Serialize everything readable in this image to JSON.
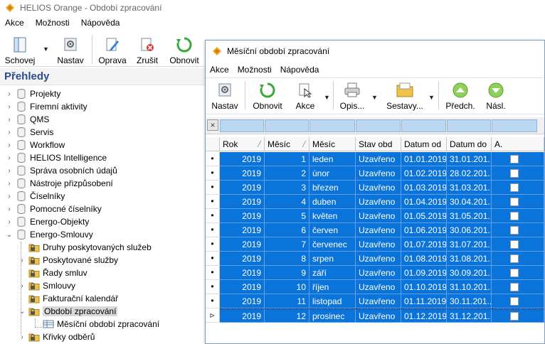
{
  "app": {
    "title": "HELIOS Orange - Období zpracování",
    "menu": [
      "Akce",
      "Možnosti",
      "Nápověda"
    ],
    "toolbar": {
      "schovej": "Schovej",
      "nastav": "Nastav",
      "oprava": "Oprava",
      "zrusit": "Zrušit",
      "obnovit": "Obnovit"
    }
  },
  "sidebar": {
    "header": "Přehledy",
    "items": [
      {
        "label": "Projekty"
      },
      {
        "label": "Firemní aktivity"
      },
      {
        "label": "QMS"
      },
      {
        "label": "Servis"
      },
      {
        "label": "Workflow"
      },
      {
        "label": "HELIOS Intelligence"
      },
      {
        "label": "Správa osobních údajů"
      },
      {
        "label": "Nástroje přizpůsobení"
      },
      {
        "label": "Číselníky"
      },
      {
        "label": "Pomocné číselníky"
      },
      {
        "label": "Energo-Objekty"
      },
      {
        "label": "Energo-Smlouvy"
      },
      {
        "label": "Druhy poskytovaných služeb"
      },
      {
        "label": "Poskytované služby"
      },
      {
        "label": "Řady smluv"
      },
      {
        "label": "Smlouvy"
      },
      {
        "label": "Fakturační kalendář"
      },
      {
        "label": "Období zpracování"
      },
      {
        "label": "Měsíční období zpracování"
      },
      {
        "label": "Křivky odběrů"
      }
    ]
  },
  "child": {
    "title": "Měsíční období zpracování",
    "menu": [
      "Akce",
      "Možnosti",
      "Nápověda"
    ],
    "toolbar": {
      "nastav": "Nastav",
      "obnovit": "Obnovit",
      "akce": "Akce",
      "opis": "Opis...",
      "sestavy": "Sestavy...",
      "predch": "Předch.",
      "nasl": "Násl."
    },
    "columns": [
      "Rok",
      "Měsíc",
      "Měsíc",
      "Stav obd",
      "Datum od",
      "Datum do",
      "A."
    ],
    "rows": [
      {
        "rok": "2019",
        "mesic": "1",
        "nazev": "leden",
        "stav": "Uzavřeno",
        "od": "01.01.2019",
        "do": "31.01.201..."
      },
      {
        "rok": "2019",
        "mesic": "2",
        "nazev": "únor",
        "stav": "Uzavřeno",
        "od": "01.02.2019",
        "do": "28.02.201..."
      },
      {
        "rok": "2019",
        "mesic": "3",
        "nazev": "březen",
        "stav": "Uzavřeno",
        "od": "01.03.2019",
        "do": "31.03.201..."
      },
      {
        "rok": "2019",
        "mesic": "4",
        "nazev": "duben",
        "stav": "Uzavřeno",
        "od": "01.04.2019",
        "do": "30.04.201..."
      },
      {
        "rok": "2019",
        "mesic": "5",
        "nazev": "květen",
        "stav": "Uzavřeno",
        "od": "01.05.2019",
        "do": "31.05.201..."
      },
      {
        "rok": "2019",
        "mesic": "6",
        "nazev": "červen",
        "stav": "Uzavřeno",
        "od": "01.06.2019",
        "do": "30.06.201..."
      },
      {
        "rok": "2019",
        "mesic": "7",
        "nazev": "červenec",
        "stav": "Uzavřeno",
        "od": "01.07.2019",
        "do": "31.07.201..."
      },
      {
        "rok": "2019",
        "mesic": "8",
        "nazev": "srpen",
        "stav": "Uzavřeno",
        "od": "01.08.2019",
        "do": "31.08.201..."
      },
      {
        "rok": "2019",
        "mesic": "9",
        "nazev": "září",
        "stav": "Uzavřeno",
        "od": "01.09.2019",
        "do": "30.09.201..."
      },
      {
        "rok": "2019",
        "mesic": "10",
        "nazev": "říjen",
        "stav": "Uzavřeno",
        "od": "01.10.2019",
        "do": "31.10.201..."
      },
      {
        "rok": "2019",
        "mesic": "11",
        "nazev": "listopad",
        "stav": "Uzavřeno",
        "od": "01.11.2019",
        "do": "30.11.201..."
      },
      {
        "rok": "2019",
        "mesic": "12",
        "nazev": "prosinec",
        "stav": "Uzavřeno",
        "od": "01.12.2019",
        "do": "31.12.201..."
      }
    ]
  },
  "colors": {
    "selection": "#0a74da",
    "filter": "#bcd7f2",
    "header_blue": "#2b4d8c"
  }
}
